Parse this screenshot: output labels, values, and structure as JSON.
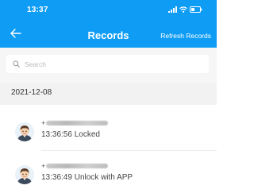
{
  "status_bar": {
    "time": "13:37"
  },
  "header": {
    "title": "Records",
    "refresh_label": "Refresh Records",
    "color": "#0f9cf5"
  },
  "search": {
    "placeholder": "Search"
  },
  "date_group": {
    "date": "2021-12-08"
  },
  "records": [
    {
      "phone_prefix": "+",
      "time": "13:36:56",
      "event": "Locked"
    },
    {
      "phone_prefix": "+",
      "time": "13:36:49",
      "event": "Unlock with APP"
    }
  ],
  "icons": {
    "back": "arrow-left-icon",
    "search": "search-icon",
    "avatar": "user-avatar-icon",
    "signal": "signal-icon",
    "wifi": "wifi-icon",
    "battery": "battery-icon"
  }
}
